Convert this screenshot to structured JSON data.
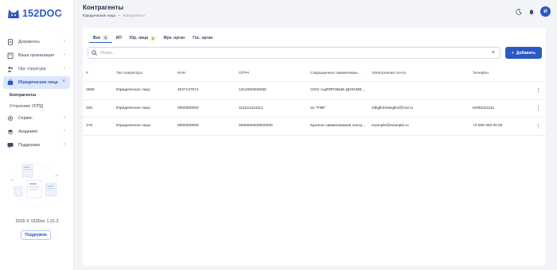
{
  "brand": {
    "name": "152DOC"
  },
  "sidebar": {
    "items": [
      {
        "label": "Документы",
        "icon": "document-icon"
      },
      {
        "label": "Ваша организация",
        "icon": "building-icon"
      },
      {
        "label": "Орг. структура",
        "icon": "people-icon"
      },
      {
        "label": "Юридические лица",
        "icon": "legal-entity-icon"
      },
      {
        "label": "Сервис",
        "icon": "gear-icon"
      },
      {
        "label": "Академия",
        "icon": "graduation-cap-icon"
      },
      {
        "label": "Поддержка",
        "icon": "chat-icon"
      }
    ],
    "subitems": [
      {
        "label": "Контрагенты"
      },
      {
        "label": "Сторонние УОПД"
      }
    ],
    "copyright": "2025 © 152Doc 1.21.2",
    "support_button": "Поддержка"
  },
  "header": {
    "title": "Контрагенты",
    "breadcrumb": [
      "Юридические лица",
      "Контрагенты"
    ],
    "avatar": "И"
  },
  "tabs": [
    {
      "label": "Все",
      "badge": "3"
    },
    {
      "label": "ИП",
      "badge": ""
    },
    {
      "label": "Юр. лица",
      "badge": "3"
    },
    {
      "label": "Мун. орган",
      "badge": ""
    },
    {
      "label": "Гос. орган",
      "badge": ""
    }
  ],
  "search": {
    "placeholder": "Поиск...",
    "value": ""
  },
  "add_button": {
    "label": "Добавить"
  },
  "table": {
    "columns": [
      "#",
      "Тип оператора",
      "ИНН",
      "ОГРН",
      "Сокращенное наименован...",
      "Электронная почта",
      "Телефон"
    ],
    "rows": [
      [
        "1965",
        "Юридическое лицо",
        "4027147671",
        "1214000009280",
        "ООО «ЦИФРОВЫЕ ДОКУМЕ...",
        "",
        ""
      ],
      [
        "226",
        "Юридическое лицо",
        "0000000000",
        "1111111111111",
        "ао \"РИК\"",
        "sdkglhinsdegkin@mai.ru",
        "84951111111"
      ],
      [
        "178",
        "Юридическое лица",
        "0000000000",
        "0000000000000000",
        "Краткое наименование контр...",
        "example@example.ru",
        "+0 000 000 00 00"
      ]
    ]
  },
  "colors": {
    "accent": "#2b59c3",
    "bg": "#f3f4f7"
  }
}
